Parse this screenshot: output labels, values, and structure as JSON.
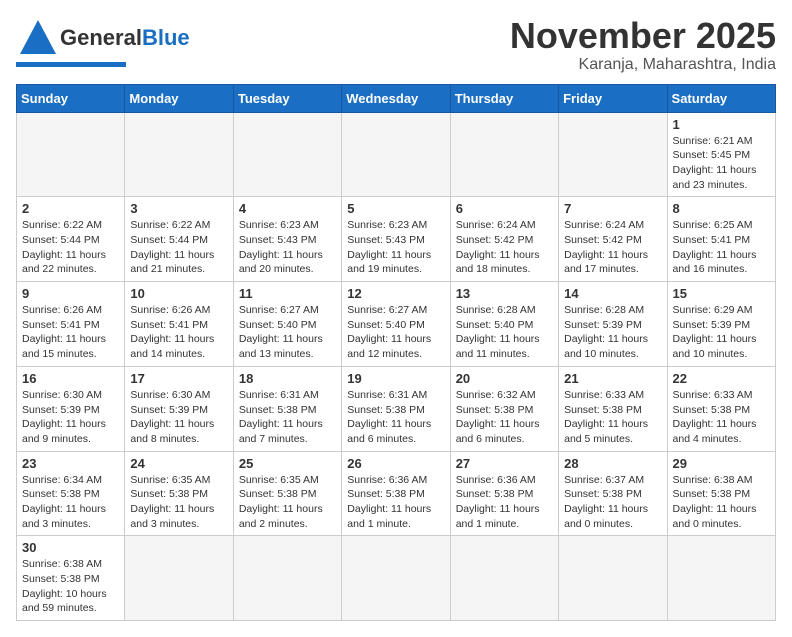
{
  "header": {
    "logo_general": "General",
    "logo_blue": "Blue",
    "month_title": "November 2025",
    "location": "Karanja, Maharashtra, India"
  },
  "weekdays": [
    "Sunday",
    "Monday",
    "Tuesday",
    "Wednesday",
    "Thursday",
    "Friday",
    "Saturday"
  ],
  "days": [
    {
      "date": "",
      "info": ""
    },
    {
      "date": "",
      "info": ""
    },
    {
      "date": "",
      "info": ""
    },
    {
      "date": "",
      "info": ""
    },
    {
      "date": "",
      "info": ""
    },
    {
      "date": "",
      "info": ""
    },
    {
      "date": "1",
      "info": "Sunrise: 6:21 AM\nSunset: 5:45 PM\nDaylight: 11 hours and 23 minutes."
    },
    {
      "date": "2",
      "info": "Sunrise: 6:22 AM\nSunset: 5:44 PM\nDaylight: 11 hours and 22 minutes."
    },
    {
      "date": "3",
      "info": "Sunrise: 6:22 AM\nSunset: 5:44 PM\nDaylight: 11 hours and 21 minutes."
    },
    {
      "date": "4",
      "info": "Sunrise: 6:23 AM\nSunset: 5:43 PM\nDaylight: 11 hours and 20 minutes."
    },
    {
      "date": "5",
      "info": "Sunrise: 6:23 AM\nSunset: 5:43 PM\nDaylight: 11 hours and 19 minutes."
    },
    {
      "date": "6",
      "info": "Sunrise: 6:24 AM\nSunset: 5:42 PM\nDaylight: 11 hours and 18 minutes."
    },
    {
      "date": "7",
      "info": "Sunrise: 6:24 AM\nSunset: 5:42 PM\nDaylight: 11 hours and 17 minutes."
    },
    {
      "date": "8",
      "info": "Sunrise: 6:25 AM\nSunset: 5:41 PM\nDaylight: 11 hours and 16 minutes."
    },
    {
      "date": "9",
      "info": "Sunrise: 6:26 AM\nSunset: 5:41 PM\nDaylight: 11 hours and 15 minutes."
    },
    {
      "date": "10",
      "info": "Sunrise: 6:26 AM\nSunset: 5:41 PM\nDaylight: 11 hours and 14 minutes."
    },
    {
      "date": "11",
      "info": "Sunrise: 6:27 AM\nSunset: 5:40 PM\nDaylight: 11 hours and 13 minutes."
    },
    {
      "date": "12",
      "info": "Sunrise: 6:27 AM\nSunset: 5:40 PM\nDaylight: 11 hours and 12 minutes."
    },
    {
      "date": "13",
      "info": "Sunrise: 6:28 AM\nSunset: 5:40 PM\nDaylight: 11 hours and 11 minutes."
    },
    {
      "date": "14",
      "info": "Sunrise: 6:28 AM\nSunset: 5:39 PM\nDaylight: 11 hours and 10 minutes."
    },
    {
      "date": "15",
      "info": "Sunrise: 6:29 AM\nSunset: 5:39 PM\nDaylight: 11 hours and 10 minutes."
    },
    {
      "date": "16",
      "info": "Sunrise: 6:30 AM\nSunset: 5:39 PM\nDaylight: 11 hours and 9 minutes."
    },
    {
      "date": "17",
      "info": "Sunrise: 6:30 AM\nSunset: 5:39 PM\nDaylight: 11 hours and 8 minutes."
    },
    {
      "date": "18",
      "info": "Sunrise: 6:31 AM\nSunset: 5:38 PM\nDaylight: 11 hours and 7 minutes."
    },
    {
      "date": "19",
      "info": "Sunrise: 6:31 AM\nSunset: 5:38 PM\nDaylight: 11 hours and 6 minutes."
    },
    {
      "date": "20",
      "info": "Sunrise: 6:32 AM\nSunset: 5:38 PM\nDaylight: 11 hours and 6 minutes."
    },
    {
      "date": "21",
      "info": "Sunrise: 6:33 AM\nSunset: 5:38 PM\nDaylight: 11 hours and 5 minutes."
    },
    {
      "date": "22",
      "info": "Sunrise: 6:33 AM\nSunset: 5:38 PM\nDaylight: 11 hours and 4 minutes."
    },
    {
      "date": "23",
      "info": "Sunrise: 6:34 AM\nSunset: 5:38 PM\nDaylight: 11 hours and 3 minutes."
    },
    {
      "date": "24",
      "info": "Sunrise: 6:35 AM\nSunset: 5:38 PM\nDaylight: 11 hours and 3 minutes."
    },
    {
      "date": "25",
      "info": "Sunrise: 6:35 AM\nSunset: 5:38 PM\nDaylight: 11 hours and 2 minutes."
    },
    {
      "date": "26",
      "info": "Sunrise: 6:36 AM\nSunset: 5:38 PM\nDaylight: 11 hours and 1 minute."
    },
    {
      "date": "27",
      "info": "Sunrise: 6:36 AM\nSunset: 5:38 PM\nDaylight: 11 hours and 1 minute."
    },
    {
      "date": "28",
      "info": "Sunrise: 6:37 AM\nSunset: 5:38 PM\nDaylight: 11 hours and 0 minutes."
    },
    {
      "date": "29",
      "info": "Sunrise: 6:38 AM\nSunset: 5:38 PM\nDaylight: 11 hours and 0 minutes."
    },
    {
      "date": "30",
      "info": "Sunrise: 6:38 AM\nSunset: 5:38 PM\nDaylight: 10 hours and 59 minutes."
    },
    {
      "date": "",
      "info": ""
    }
  ]
}
